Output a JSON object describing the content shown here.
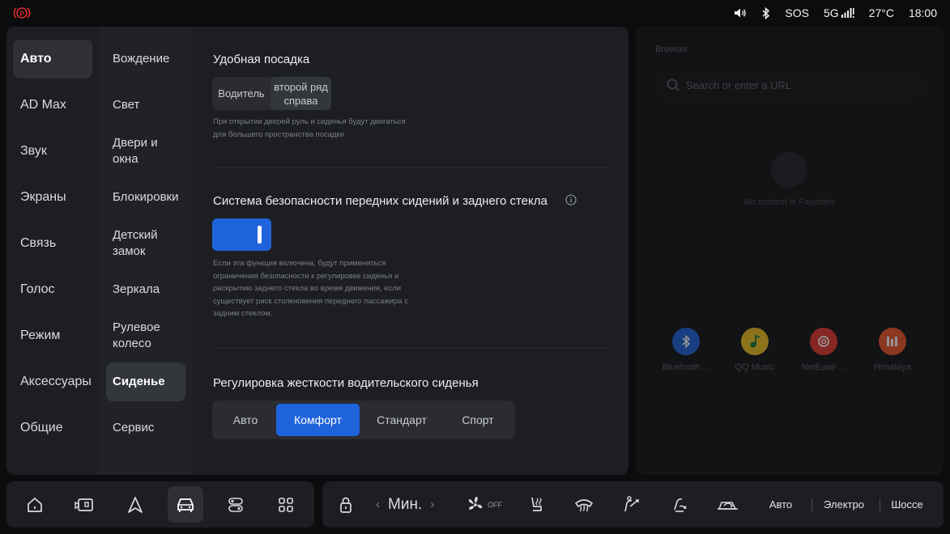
{
  "status_bar": {
    "sos": "SOS",
    "network": "5G",
    "temperature": "27°C",
    "time": "18:00"
  },
  "nav_primary": [
    {
      "label": "Авто",
      "active": true
    },
    {
      "label": "AD Max"
    },
    {
      "label": "Звук"
    },
    {
      "label": "Экраны"
    },
    {
      "label": "Связь"
    },
    {
      "label": "Голос"
    },
    {
      "label": "Режим"
    },
    {
      "label": "Аксессуары"
    },
    {
      "label": "Общие"
    }
  ],
  "nav_secondary": [
    {
      "label": "Вождение"
    },
    {
      "label": "Свет"
    },
    {
      "label": "Двери и окна"
    },
    {
      "label": "Блокировки"
    },
    {
      "label": "Детский замок"
    },
    {
      "label": "Зеркала"
    },
    {
      "label": "Рулевое колесо"
    },
    {
      "label": "Сиденье",
      "active": true
    },
    {
      "label": "Сервис"
    }
  ],
  "easy_entry": {
    "title": "Удобная посадка",
    "option_driver": "Водитель",
    "option_rear": "второй ряд справа",
    "note": "При открытии дверей руль и сиденья будут двигаться для большего пространства посадки"
  },
  "safety": {
    "title": "Система безопасности передних сидений и заднего стекла",
    "enabled": true,
    "note": "Если эта функция включена, будут применяться ограничения безопасности к регулировке сиденья и раскрытию заднего стекла во время движения, если существует риск столкновения переднего пассажира с задним стеклом."
  },
  "firmness": {
    "title": "Регулировка жесткости водительского сиденья",
    "options": [
      "Авто",
      "Комфорт",
      "Стандарт",
      "Спорт"
    ],
    "selected": "Комфорт"
  },
  "browser": {
    "title": "Browser",
    "search_placeholder": "Search or enter a URL",
    "empty_text": "No content is Favorites",
    "apps": [
      {
        "label": "Bluetooth ...",
        "icon": "bluetooth-icon",
        "color": "#1f63dc"
      },
      {
        "label": "QQ Music",
        "icon": "qq-music-icon",
        "color": "#f2c320"
      },
      {
        "label": "NetEase ...",
        "icon": "netease-icon",
        "color": "#e8382f"
      },
      {
        "label": "Himalaya",
        "icon": "himalaya-icon",
        "color": "#f0572c"
      }
    ]
  },
  "climate": {
    "temperature": "Мин.",
    "fan": "OFF",
    "modes": [
      "Авто",
      "Электро",
      "Шоссе"
    ]
  },
  "colors": {
    "accent": "#1f63dc",
    "panel": "#1c1e22",
    "background": "#0b0c0e"
  }
}
